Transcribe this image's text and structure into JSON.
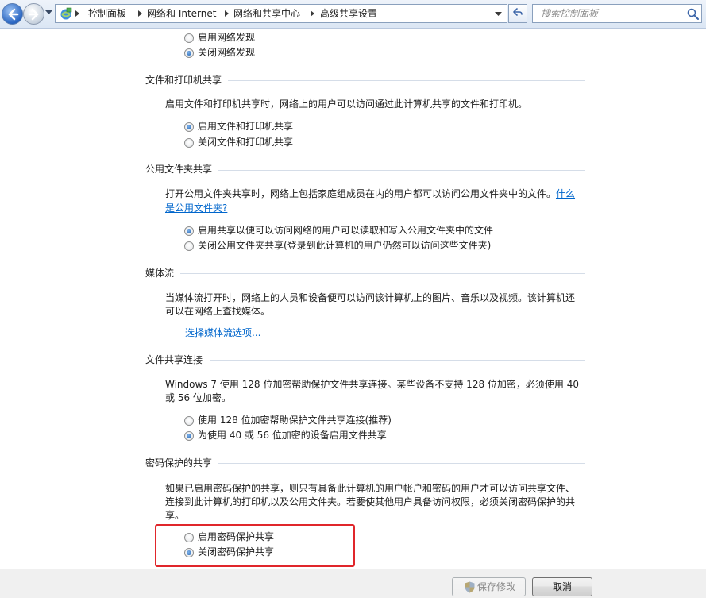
{
  "address_bar": {
    "breadcrumbs": [
      "控制面板",
      "网络和 Internet",
      "网络和共享中心",
      "高级共享设置"
    ],
    "search_placeholder": "搜索控制面板"
  },
  "network_discovery": {
    "options": [
      {
        "label": "启用网络发现",
        "selected": false
      },
      {
        "label": "关闭网络发现",
        "selected": true
      }
    ]
  },
  "file_printer_sharing": {
    "heading": "文件和打印机共享",
    "description": "启用文件和打印机共享时，网络上的用户可以访问通过此计算机共享的文件和打印机。",
    "options": [
      {
        "label": "启用文件和打印机共享",
        "selected": true
      },
      {
        "label": "关闭文件和打印机共享",
        "selected": false
      }
    ]
  },
  "public_folder_sharing": {
    "heading": "公用文件夹共享",
    "description": "打开公用文件夹共享时，网络上包括家庭组成员在内的用户都可以访问公用文件夹中的文件。",
    "help_link_line1": "什么",
    "help_link_line2": "是公用文件夹?",
    "options": [
      {
        "label": "启用共享以便可以访问网络的用户可以读取和写入公用文件夹中的文件",
        "selected": true
      },
      {
        "label": "关闭公用文件夹共享(登录到此计算机的用户仍然可以访问这些文件夹)",
        "selected": false
      }
    ]
  },
  "media_streaming": {
    "heading": "媒体流",
    "description_line1": "当媒体流打开时，网络上的人员和设备便可以访问该计算机上的图片、音乐以及视频。该计算机还",
    "description_line2": "可以在网络上查找媒体。",
    "link": "选择媒体流选项..."
  },
  "file_sharing_connections": {
    "heading": "文件共享连接",
    "description_line1": "Windows 7 使用 128 位加密帮助保护文件共享连接。某些设备不支持 128 位加密，必须使用 40",
    "description_line2": "或 56 位加密。",
    "options": [
      {
        "label": "使用 128 位加密帮助保护文件共享连接(推荐)",
        "selected": false
      },
      {
        "label": "为使用 40 或 56 位加密的设备启用文件共享",
        "selected": true
      }
    ]
  },
  "password_protected_sharing": {
    "heading": "密码保护的共享",
    "description_line1": "如果已启用密码保护的共享，则只有具备此计算机的用户帐户和密码的用户才可以访问共享文件、",
    "description_line2": "连接到此计算机的打印机以及公用文件夹。若要使其他用户具备访问权限，必须关闭密码保护的共",
    "description_line3": "享。",
    "options": [
      {
        "label": "启用密码保护共享",
        "selected": false
      },
      {
        "label": "关闭密码保护共享",
        "selected": true
      }
    ]
  },
  "footer": {
    "save_label": "保存修改",
    "cancel_label": "取消"
  },
  "colors": {
    "link": "#0066cc",
    "highlight_border": "#e0262b",
    "radio_selected": "#1d5fae"
  },
  "icons": [
    "back-arrow-icon",
    "forward-arrow-icon",
    "network-icon",
    "refresh-icon",
    "search-icon",
    "shield-icon"
  ]
}
